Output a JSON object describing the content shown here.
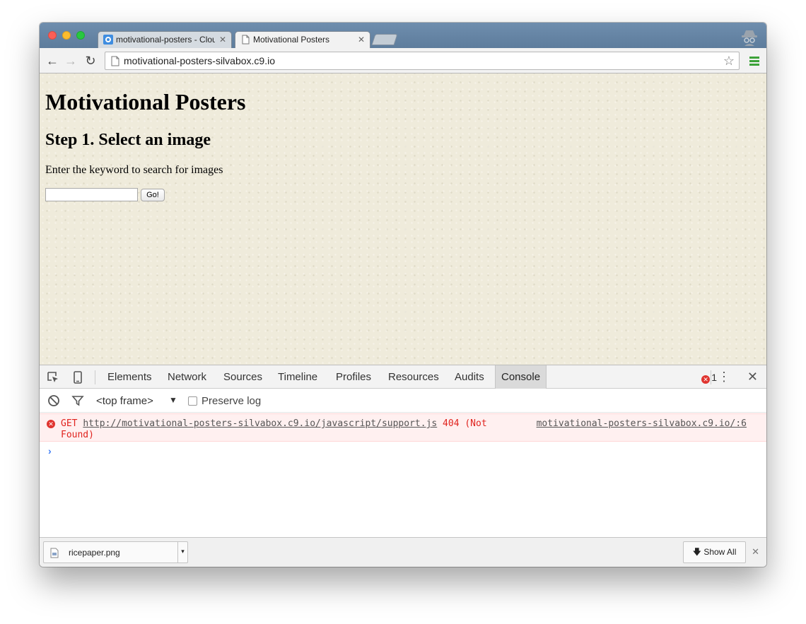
{
  "browser": {
    "tabs": [
      {
        "title": "motivational-posters - Clou",
        "active": false
      },
      {
        "title": "Motivational Posters",
        "active": true
      }
    ],
    "url": "motivational-posters-silvabox.c9.io"
  },
  "page": {
    "heading": "Motivational Posters",
    "step_heading": "Step 1. Select an image",
    "instruction": "Enter the keyword to search for images",
    "search_value": "",
    "go_label": "Go!"
  },
  "devtools": {
    "tabs": [
      "Elements",
      "Network",
      "Sources",
      "Timeline",
      "Profiles",
      "Resources",
      "Audits",
      "Console"
    ],
    "active_tab": "Console",
    "error_count": "1",
    "frame_selector": "<top frame>",
    "preserve_log_label": "Preserve log",
    "preserve_log_checked": false,
    "console_error": {
      "method": "GET",
      "url": "http://motivational-posters-silvabox.c9.io/javascript/support.js",
      "status": "404 (Not",
      "status_cont": "Found)",
      "source": "motivational-posters-silvabox.c9.io/:6"
    }
  },
  "downloads": {
    "file_name": "ricepaper.png",
    "show_all_label": "Show All"
  },
  "colors": {
    "page_background": "#efebdb",
    "error_text": "#e0231e",
    "error_background": "#fff0f0",
    "prompt_accent": "#3f7df5",
    "menu_green": "#3da33a"
  }
}
